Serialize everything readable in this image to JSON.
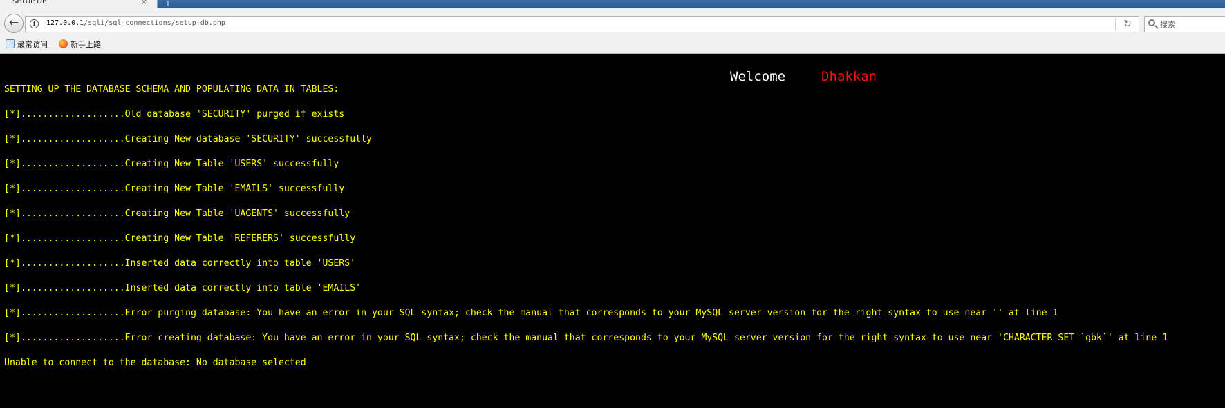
{
  "browser": {
    "tab_title": "SETUP DB",
    "tab_close": "×",
    "new_tab": "+",
    "url_host": "127.0.0.1",
    "url_path": "/sqli/sql-connections/setup-db.php",
    "search_placeholder": "搜索",
    "bookmarks": [
      {
        "label": "最常访问",
        "icon": "frequent-icon"
      },
      {
        "label": "新手上路",
        "icon": "firefox-icon"
      }
    ]
  },
  "page": {
    "welcome_word": "Welcome",
    "welcome_name": "Dhakkan",
    "heading": "SETTING UP THE DATABASE SCHEMA AND POPULATING DATA IN TABLES:",
    "log_lines": [
      "[*]...................Old database 'SECURITY' purged if exists",
      "[*]...................Creating New database 'SECURITY' successfully",
      "[*]...................Creating New Table 'USERS' successfully",
      "[*]...................Creating New Table 'EMAILS' successfully",
      "[*]...................Creating New Table 'UAGENTS' successfully",
      "[*]...................Creating New Table 'REFERERS' successfully",
      "[*]...................Inserted data correctly into table 'USERS'",
      "[*]...................Inserted data correctly into table 'EMAILS'",
      "[*]...................Error purging database: You have an error in your SQL syntax; check the manual that corresponds to your MySQL server version for the right syntax to use near '' at line 1",
      "[*]...................Error creating database: You have an error in your SQL syntax; check the manual that corresponds to your MySQL server version for the right syntax to use near 'CHARACTER SET `gbk`' at line 1"
    ],
    "footer": "Unable to connect to the database: No database selected"
  },
  "colors": {
    "background": "#000000",
    "log_text": "#ffff00",
    "welcome_word": "#ffffff",
    "welcome_name": "#ff1010"
  }
}
